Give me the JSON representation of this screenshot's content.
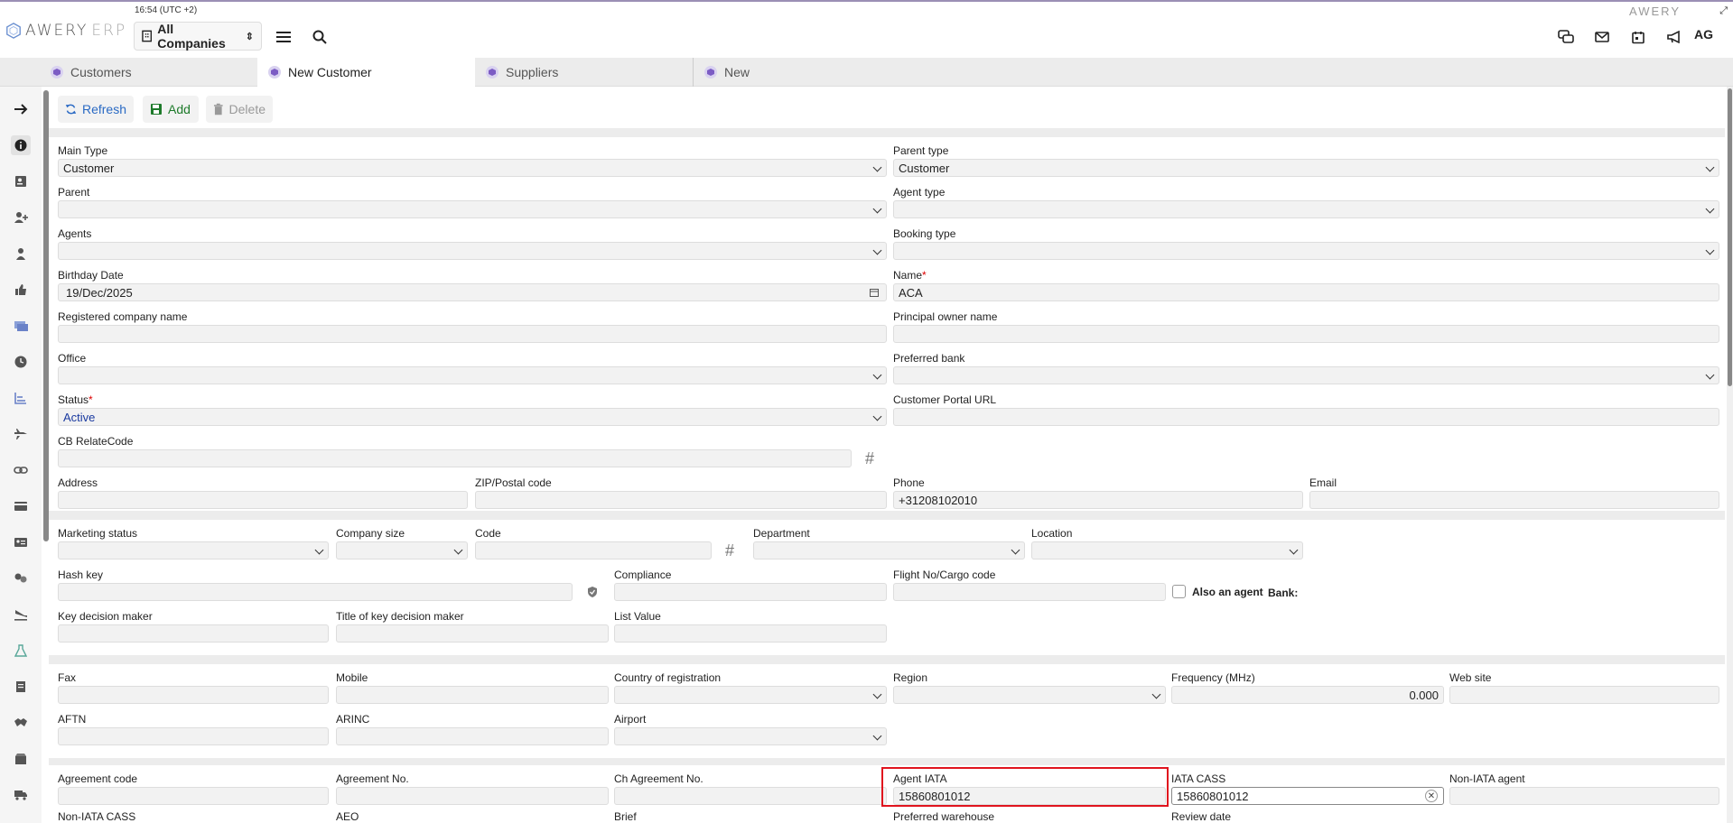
{
  "header": {
    "logo_text": "AWERY",
    "logo_suffix": "ERP",
    "time": "16:54 (UTC +2)",
    "company_selector": "All Companies",
    "brand_right": "AWERY",
    "user_initials": "AG",
    "accent_color": "#7c5cc4"
  },
  "tabs": [
    {
      "label": "Customers"
    },
    {
      "label": "New Customer"
    },
    {
      "label": "Suppliers"
    },
    {
      "label": "New"
    }
  ],
  "toolbar": {
    "refresh": "Refresh",
    "add": "Add",
    "delete": "Delete"
  },
  "form": {
    "main_type": {
      "label": "Main Type",
      "value": "Customer"
    },
    "parent_type": {
      "label": "Parent type",
      "value": "Customer"
    },
    "parent": {
      "label": "Parent",
      "value": ""
    },
    "agent_type": {
      "label": "Agent type",
      "value": ""
    },
    "agents": {
      "label": "Agents",
      "value": ""
    },
    "booking_type": {
      "label": "Booking type",
      "value": ""
    },
    "birthday_date": {
      "label": "Birthday Date",
      "value": "19/Dec/2025"
    },
    "name": {
      "label": "Name",
      "value": "ACA",
      "required": "*"
    },
    "registered_company_name": {
      "label": "Registered company name",
      "value": ""
    },
    "principal_owner_name": {
      "label": "Principal owner name",
      "value": ""
    },
    "office": {
      "label": "Office",
      "value": ""
    },
    "preferred_bank": {
      "label": "Preferred bank",
      "value": ""
    },
    "status": {
      "label": "Status",
      "value": "Active",
      "required": "*"
    },
    "customer_portal_url": {
      "label": "Customer Portal URL",
      "value": ""
    },
    "cb_relatecode": {
      "label": "CB RelateCode",
      "value": ""
    },
    "address": {
      "label": "Address",
      "value": ""
    },
    "zip": {
      "label": "ZIP/Postal code",
      "value": ""
    },
    "phone": {
      "label": "Phone",
      "value": "+31208102010"
    },
    "email": {
      "label": "Email",
      "value": ""
    },
    "marketing_status": {
      "label": "Marketing status",
      "value": ""
    },
    "company_size": {
      "label": "Company size",
      "value": ""
    },
    "code": {
      "label": "Code",
      "value": ""
    },
    "department": {
      "label": "Department",
      "value": ""
    },
    "location": {
      "label": "Location",
      "value": ""
    },
    "hash_key": {
      "label": "Hash key",
      "value": ""
    },
    "compliance": {
      "label": "Compliance",
      "value": ""
    },
    "flight_no": {
      "label": "Flight No/Cargo code",
      "value": ""
    },
    "also_agent": {
      "label": "Also an agent"
    },
    "bank": {
      "label": "Bank:"
    },
    "key_decision_maker": {
      "label": "Key decision maker",
      "value": ""
    },
    "title_key_decision_maker": {
      "label": "Title of key decision maker",
      "value": ""
    },
    "list_value": {
      "label": "List Value",
      "value": ""
    },
    "fax": {
      "label": "Fax",
      "value": ""
    },
    "mobile": {
      "label": "Mobile",
      "value": ""
    },
    "country_registration": {
      "label": "Country of registration",
      "value": ""
    },
    "region": {
      "label": "Region",
      "value": ""
    },
    "frequency": {
      "label": "Frequency (MHz)",
      "value": "0.000"
    },
    "web_site": {
      "label": "Web site",
      "value": ""
    },
    "aftn": {
      "label": "AFTN",
      "value": ""
    },
    "arinc": {
      "label": "ARINC",
      "value": ""
    },
    "airport": {
      "label": "Airport",
      "value": ""
    },
    "agreement_code": {
      "label": "Agreement code",
      "value": ""
    },
    "agreement_no": {
      "label": "Agreement No.",
      "value": ""
    },
    "ch_agreement_no": {
      "label": "Ch Agreement No.",
      "value": ""
    },
    "agent_iata": {
      "label": "Agent IATA",
      "value": "15860801012"
    },
    "iata_cass": {
      "label": "IATA CASS",
      "value": "15860801012"
    },
    "non_iata_agent": {
      "label": "Non-IATA agent",
      "value": ""
    },
    "non_iata_cass": {
      "label": "Non-IATA CASS"
    },
    "aeo": {
      "label": "AEO"
    },
    "brief": {
      "label": "Brief"
    },
    "preferred_warehouse": {
      "label": "Preferred warehouse"
    },
    "review_date": {
      "label": "Review date"
    }
  }
}
